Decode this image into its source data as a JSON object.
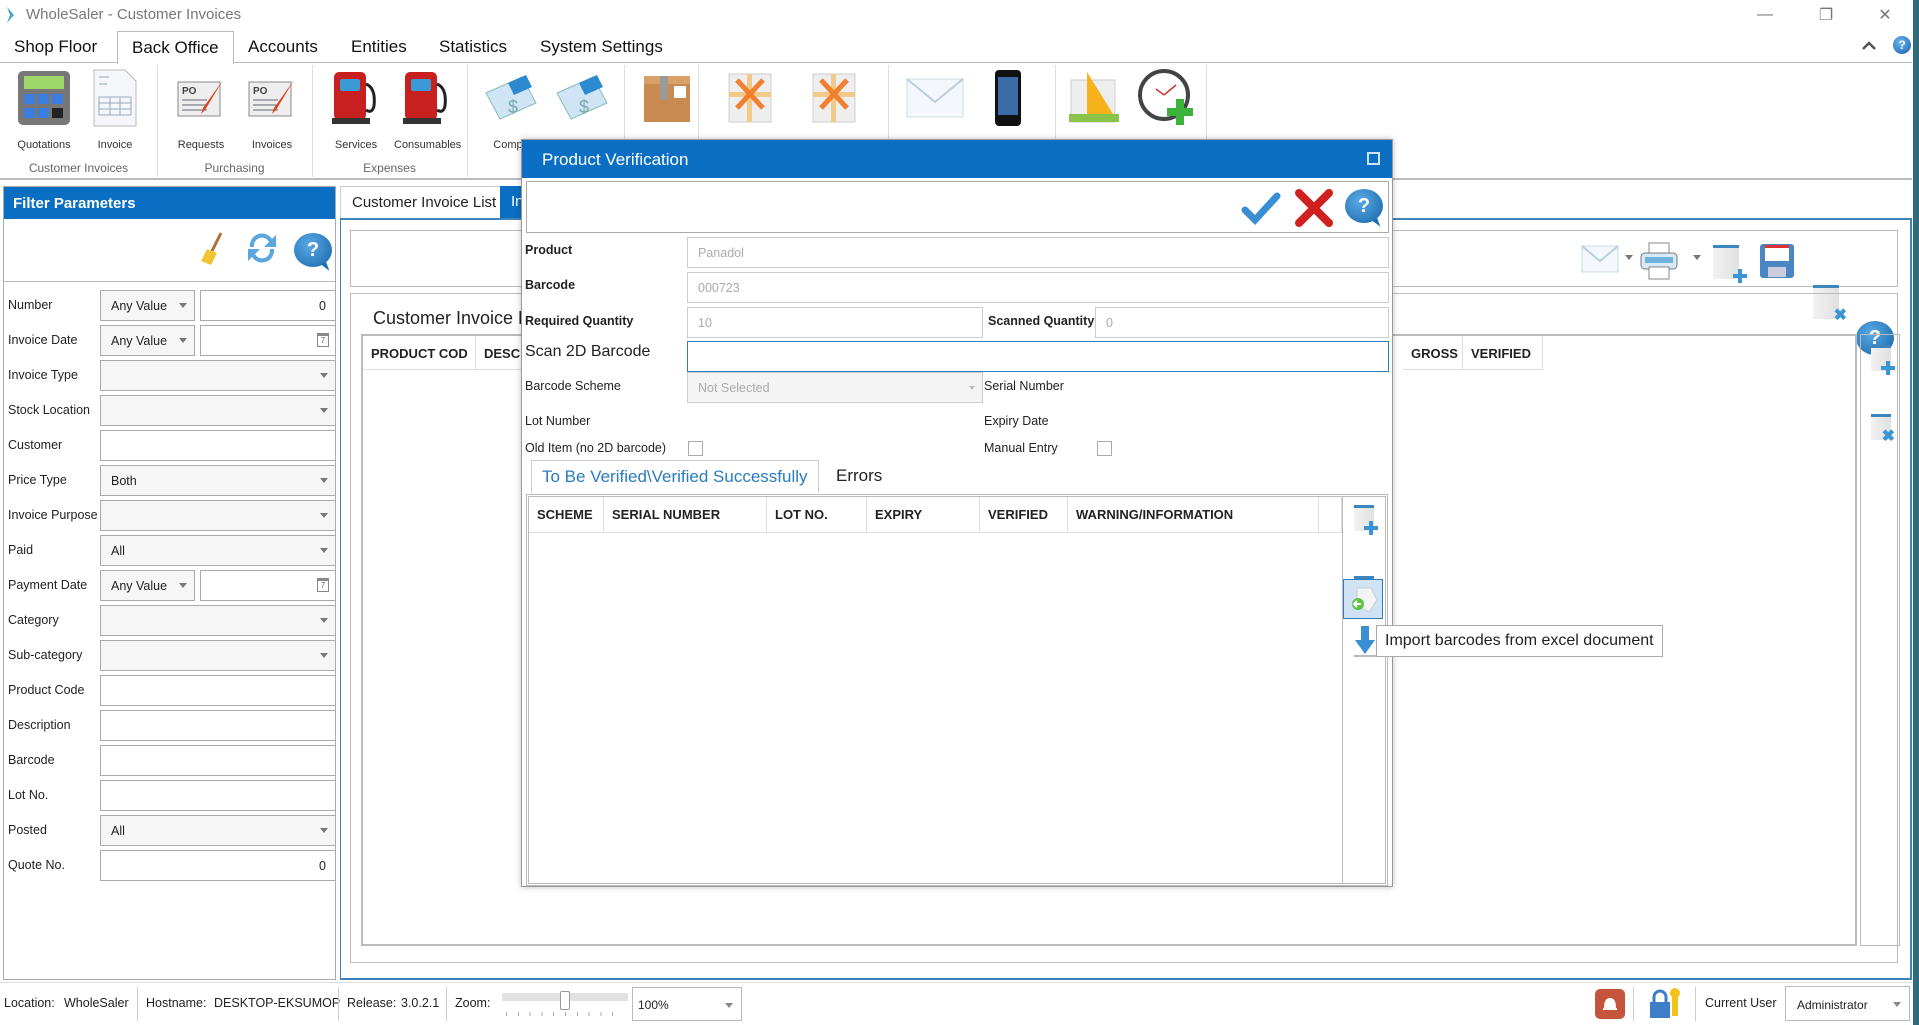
{
  "window": {
    "title": "WholeSaler - Customer Invoices",
    "controls": {
      "minimize": "—",
      "restore": "❐",
      "close": "✕"
    }
  },
  "menu": {
    "tabs": [
      {
        "label": "Shop Floor",
        "active": false
      },
      {
        "label": "Back Office",
        "active": true
      },
      {
        "label": "Accounts",
        "active": false
      },
      {
        "label": "Entities",
        "active": false
      },
      {
        "label": "Statistics",
        "active": false
      },
      {
        "label": "System Settings",
        "active": false
      }
    ],
    "collapse_icon": "chevron-up-icon",
    "help_icon": "help-icon"
  },
  "ribbon": {
    "groups": [
      {
        "label": "Customer Invoices",
        "buttons": [
          {
            "label": "Quotations",
            "icon": "calculator-icon"
          },
          {
            "label": "Invoice",
            "icon": "invoice-document-icon"
          }
        ]
      },
      {
        "label": "Purchasing",
        "buttons": [
          {
            "label": "Requests",
            "icon": "purchase-order-icon"
          },
          {
            "label": "Invoices",
            "icon": "purchase-order-icon"
          }
        ]
      },
      {
        "label": "Expenses",
        "buttons": [
          {
            "label": "Services",
            "icon": "fuel-pump-icon"
          },
          {
            "label": "Consumables",
            "icon": "fuel-pump-icon"
          }
        ]
      },
      {
        "label": "",
        "buttons": [
          {
            "label": "Compa",
            "icon": "cheque-card-icon"
          },
          {
            "label": "",
            "icon": "cheque-card-icon"
          }
        ]
      },
      {
        "label": "",
        "buttons": [
          {
            "label": "",
            "icon": "package-box-icon"
          }
        ]
      },
      {
        "label": "",
        "buttons": [
          {
            "label": "",
            "icon": "gift-icon"
          },
          {
            "label": "",
            "icon": "gift-icon"
          }
        ]
      },
      {
        "label": "",
        "buttons": [
          {
            "label": "",
            "icon": "envelope-icon"
          },
          {
            "label": "",
            "icon": "mobile-phone-icon"
          }
        ]
      },
      {
        "label": "",
        "buttons": [
          {
            "label": "",
            "icon": "ruler-triangle-icon"
          },
          {
            "label": "",
            "icon": "clock-add-icon"
          }
        ]
      }
    ]
  },
  "filter_panel": {
    "title": "Filter Parameters",
    "tools": [
      "broom-clear-icon",
      "refresh-icon",
      "help-icon"
    ],
    "fields": [
      {
        "label": "Number",
        "operator": "Any Value",
        "value": "0",
        "type": "op-number"
      },
      {
        "label": "Invoice Date",
        "operator": "Any Value",
        "value": "",
        "type": "op-date"
      },
      {
        "label": "Invoice Type",
        "value": "",
        "type": "select"
      },
      {
        "label": "Stock Location",
        "value": "",
        "type": "select"
      },
      {
        "label": "Customer",
        "value": "",
        "type": "text"
      },
      {
        "label": "Price Type",
        "value": "Both",
        "type": "select"
      },
      {
        "label": "Invoice Purpose",
        "value": "",
        "type": "select"
      },
      {
        "label": "Paid",
        "value": "All",
        "type": "select"
      },
      {
        "label": "Payment Date",
        "operator": "Any Value",
        "value": "",
        "type": "op-date"
      },
      {
        "label": "Category",
        "value": "",
        "type": "select"
      },
      {
        "label": "Sub-category",
        "value": "",
        "type": "select"
      },
      {
        "label": "Product Code",
        "value": "",
        "type": "text"
      },
      {
        "label": "Description",
        "value": "",
        "type": "text"
      },
      {
        "label": "Barcode",
        "value": "",
        "type": "text"
      },
      {
        "label": "Lot No.",
        "value": "",
        "type": "text"
      },
      {
        "label": "Posted",
        "value": "All",
        "type": "select"
      },
      {
        "label": "Quote No.",
        "value": "0",
        "type": "number"
      }
    ]
  },
  "main": {
    "tabs": [
      {
        "label": "Customer Invoice List"
      },
      {
        "label": "In"
      }
    ],
    "toolbar": [
      "envelope-icon",
      "printer-icon",
      "new-document-icon",
      "save-icon",
      "delete-document-icon",
      "help-icon"
    ],
    "detail_title": "Customer Invoice D",
    "grid_columns_left": [
      "PRODUCT COD",
      "DESCR"
    ],
    "grid_columns_right": [
      "GROSS",
      "VERIFIED"
    ]
  },
  "modal": {
    "title": "Product Verification",
    "product_label": "Product",
    "product_value": "Panadol",
    "barcode_label": "Barcode",
    "barcode_value": "000723",
    "required_qty_label": "Required Quantity",
    "required_qty_value": "10",
    "scanned_qty_label": "Scanned Quantity",
    "scanned_qty_value": "0",
    "scan_label": "Scan 2D Barcode",
    "scan_value": "",
    "scheme_label": "Barcode Scheme",
    "scheme_value": "Not Selected",
    "serial_label": "Serial Number",
    "lot_label": "Lot Number",
    "expiry_label": "Expiry Date",
    "old_item_label": "Old Item (no 2D barcode)",
    "old_item_checked": false,
    "manual_entry_label": "Manual Entry",
    "manual_entry_checked": false,
    "tabs": [
      {
        "label": "To Be Verified\\Verified Successfully",
        "active": true
      },
      {
        "label": "Errors",
        "active": false
      }
    ],
    "columns": [
      "SCHEME",
      "SERIAL NUMBER",
      "LOT NO.",
      "EXPIRY",
      "VERIFIED",
      "WARNING/INFORMATION"
    ],
    "rows": [],
    "tooltip": "Import barcodes from excel document"
  },
  "status_bar": {
    "location_label": "Location:",
    "location_value": "WholeSaler",
    "hostname_label": "Hostname:",
    "hostname_value": "DESKTOP-EKSUMOP",
    "release_label": "Release:",
    "release_value": "3.0.2.1",
    "zoom_label": "Zoom:",
    "zoom_value": "100%",
    "zoom_slider_fraction": 0.5,
    "current_user_label": "Current User",
    "current_user_value": "Administrator"
  },
  "colors": {
    "accent": "#0a6fc2",
    "tab_text": "#2a7bbf"
  }
}
